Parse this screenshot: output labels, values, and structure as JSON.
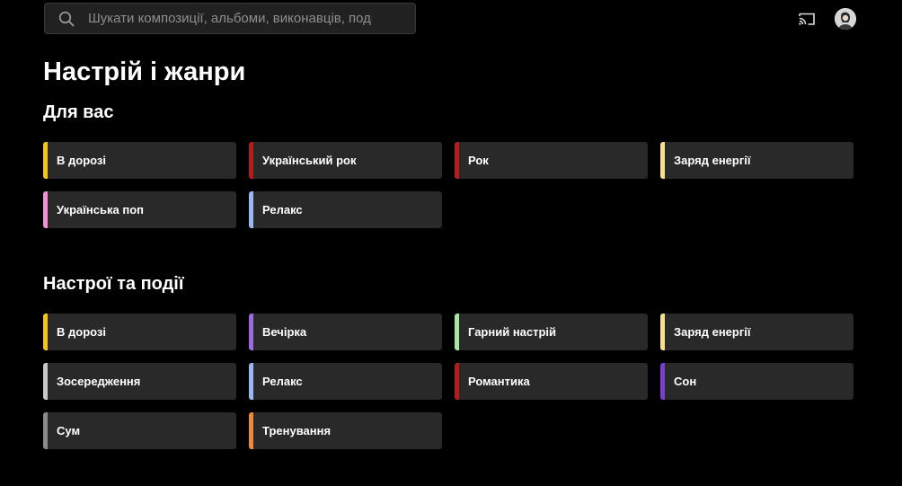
{
  "search": {
    "placeholder": "Шукати композиції, альбоми, виконавців, подкас"
  },
  "header": {
    "cast_icon": "cast-icon",
    "avatar_icon": "avatar"
  },
  "page": {
    "title": "Настрій і жанри"
  },
  "sections": [
    {
      "title": "Для вас",
      "items": [
        {
          "label": "В дорозі",
          "color": "#f5c518"
        },
        {
          "label": "Український рок",
          "color": "#b71c1c"
        },
        {
          "label": "Рок",
          "color": "#b71c1c"
        },
        {
          "label": "Заряд енергії",
          "color": "#f7e08a"
        },
        {
          "label": "Українська поп",
          "color": "#f48fd6"
        },
        {
          "label": "Релакс",
          "color": "#9ab8f0"
        }
      ]
    },
    {
      "title": "Настрої та події",
      "items": [
        {
          "label": "В дорозі",
          "color": "#f5c518"
        },
        {
          "label": "Вечірка",
          "color": "#9c6ade"
        },
        {
          "label": "Гарний настрій",
          "color": "#a5e6a0"
        },
        {
          "label": "Заряд енергії",
          "color": "#f7e08a"
        },
        {
          "label": "Зосередження",
          "color": "#c8c8c8"
        },
        {
          "label": "Релакс",
          "color": "#9ab8f0"
        },
        {
          "label": "Романтика",
          "color": "#b71c1c"
        },
        {
          "label": "Сон",
          "color": "#7a3fd0"
        },
        {
          "label": "Сум",
          "color": "#8a8a8a"
        },
        {
          "label": "Тренування",
          "color": "#f0883a"
        }
      ]
    }
  ]
}
